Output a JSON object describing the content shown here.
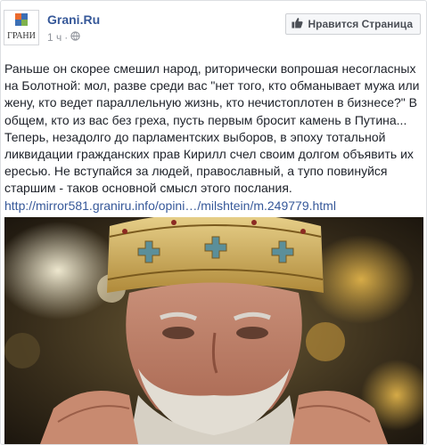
{
  "page": {
    "name": "Grani.Ru",
    "avatar_text": "ГРАНИ",
    "time": "1 ч",
    "like_button_label": "Нравится Страница"
  },
  "post": {
    "text": "Раньше он скорее смешил народ, риторически вопрошая несогласных на Болотной: мол, разве среди вас \"нет того, кто обманывает мужа или жену, кто ведет параллельную жизнь, кто нечистоплотен в бизнесе?\" В общем, кто из вас без греха, пусть первым бросит камень в Путина... Теперь, незадолго до парламентских выборов, в эпоху тотальной ликвидации гражданских прав Кирилл счел своим долгом объявить их ересью. Не вступайся за людей, православный, а тупо повинуйся старшим - таков основной смысл этого послания.",
    "link": "http://mirror581.graniru.info/opini…/milshtein/m.249779.html"
  },
  "icons": {
    "like": "thumbs-up-icon",
    "audience": "globe-icon",
    "avatar": "grani-logo"
  },
  "colors": {
    "link": "#365899",
    "meta": "#90949c",
    "button_bg": "#f6f7f9"
  }
}
